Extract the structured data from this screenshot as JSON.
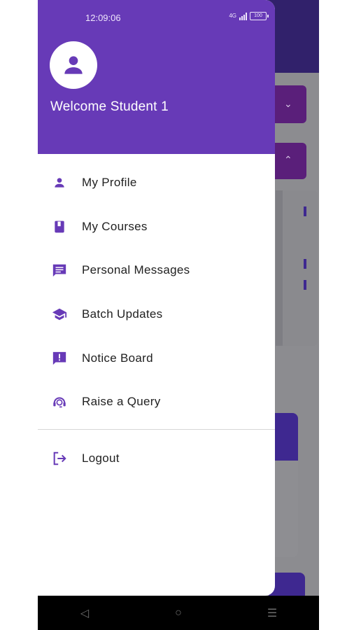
{
  "status_bar": {
    "time": "12:09:06",
    "network": "4G",
    "battery": "100"
  },
  "drawer": {
    "welcome": "Welcome Student 1",
    "menu": [
      {
        "label": "My Profile",
        "icon": "person-icon"
      },
      {
        "label": "My Courses",
        "icon": "book-icon"
      },
      {
        "label": "Personal Messages",
        "icon": "message-icon"
      },
      {
        "label": "Batch Updates",
        "icon": "school-icon"
      },
      {
        "label": "Notice Board",
        "icon": "announcement-icon"
      },
      {
        "label": "Raise a Query",
        "icon": "support-agent-icon"
      }
    ],
    "logout": {
      "label": "Logout",
      "icon": "logout-icon"
    }
  },
  "colors": {
    "primary": "#673ab7",
    "accent_dark": "#5a1f7a",
    "text": "#212121"
  },
  "navbar": {
    "back": "◁",
    "home": "○",
    "recents": "☰"
  }
}
